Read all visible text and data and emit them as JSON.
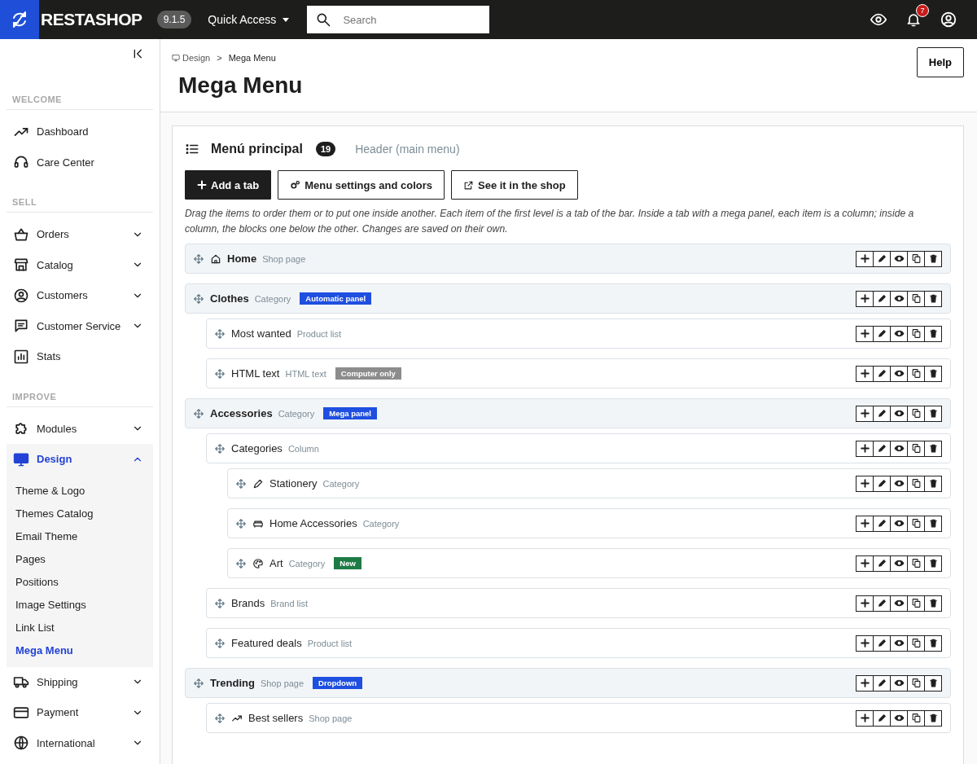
{
  "topbar": {
    "logo": "RESTASHOP",
    "version": "9.1.5",
    "quick_access": "Quick Access",
    "search": {
      "placeholder": "Search"
    },
    "notifications": "7"
  },
  "sidebar": {
    "sections": [
      {
        "title": "WELCOME",
        "items": [
          {
            "label": "Dashboard",
            "kind": "link",
            "selected": false
          },
          {
            "label": "Care Center",
            "kind": "link",
            "selected": false
          }
        ]
      },
      {
        "title": "SELL",
        "items": [
          {
            "label": "Orders",
            "kind": "group",
            "expanded": false,
            "selected": false
          },
          {
            "label": "Catalog",
            "kind": "group",
            "expanded": false,
            "selected": false
          },
          {
            "label": "Customers",
            "kind": "group",
            "expanded": false,
            "selected": false
          },
          {
            "label": "Customer Service",
            "kind": "group",
            "expanded": false,
            "selected": false
          },
          {
            "label": "Stats",
            "kind": "link",
            "selected": false
          }
        ]
      },
      {
        "title": "IMPROVE",
        "items": [
          {
            "label": "Modules",
            "kind": "group",
            "expanded": false,
            "selected": false
          },
          {
            "label": "Design",
            "kind": "group",
            "expanded": true,
            "selected": true,
            "children": [
              {
                "label": "Theme & Logo",
                "selected": false
              },
              {
                "label": "Themes Catalog",
                "selected": false
              },
              {
                "label": "Email Theme",
                "selected": false
              },
              {
                "label": "Pages",
                "selected": false
              },
              {
                "label": "Positions",
                "selected": false
              },
              {
                "label": "Image Settings",
                "selected": false
              },
              {
                "label": "Link List",
                "selected": false
              },
              {
                "label": "Mega Menu",
                "selected": true
              }
            ]
          },
          {
            "label": "Shipping",
            "kind": "group",
            "expanded": false,
            "selected": false
          },
          {
            "label": "Payment",
            "kind": "group",
            "expanded": false,
            "selected": false
          },
          {
            "label": "International",
            "kind": "group",
            "expanded": false,
            "selected": false
          }
        ]
      }
    ]
  },
  "header": {
    "breadcrumb": [
      "Design",
      "Mega Menu"
    ],
    "separator": ">",
    "title": "Mega Menu",
    "help": "Help"
  },
  "menu": {
    "title": "Menú principal",
    "count": "19",
    "location": "Header (main menu)",
    "buttons": [
      {
        "label": "Add a tab",
        "kind": "primary"
      },
      {
        "label": "Menu settings and colors",
        "kind": "settings"
      },
      {
        "label": "See it in the shop",
        "kind": "external"
      }
    ],
    "hint": "Drag the items to order them or to put one inside another. Each item of the first level is a tab of the bar. Inside a tab with a mega panel, each item is a column; inside a column, the blocks one below the other. Changes are saved on their own.",
    "items": [
      {
        "name": "Home",
        "type": "Shop page"
      },
      {
        "name": "Clothes",
        "type": "Category",
        "badge": {
          "label": "Automatic panel",
          "color": "#1f4fe0"
        },
        "children": [
          {
            "name": "Most wanted",
            "type": "Product list"
          },
          {
            "name": "HTML text",
            "type": "HTML text",
            "badge": {
              "label": "Computer only",
              "color": "#8c8c8c"
            }
          }
        ]
      },
      {
        "name": "Accessories",
        "type": "Category",
        "badge": {
          "label": "Mega panel",
          "color": "#1f4fe0"
        },
        "children": [
          {
            "name": "Categories",
            "type": "Column",
            "children": [
              {
                "name": "Stationery",
                "type": "Category"
              },
              {
                "name": "Home Accessories",
                "type": "Category"
              },
              {
                "name": "Art",
                "type": "Category",
                "badge": {
                  "label": "New",
                  "color": "#1e7b45"
                }
              }
            ]
          },
          {
            "name": "Brands",
            "type": "Brand list"
          },
          {
            "name": "Featured deals",
            "type": "Product list"
          }
        ]
      },
      {
        "name": "Trending",
        "type": "Shop page",
        "badge": {
          "label": "Dropdown",
          "color": "#1f4fe0"
        },
        "children": [
          {
            "name": "Best sellers",
            "type": "Shop page"
          }
        ]
      }
    ]
  }
}
